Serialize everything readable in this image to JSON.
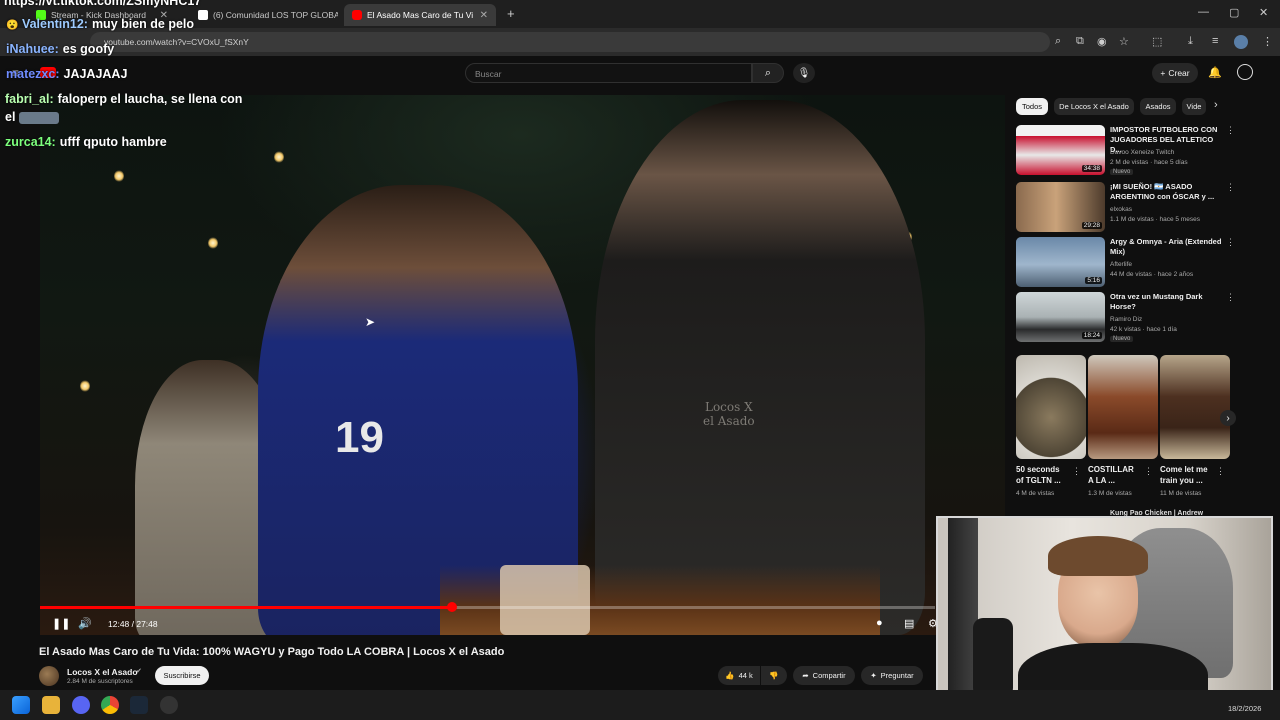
{
  "browser": {
    "tabs": [
      {
        "title": "Stream - Kick Dashboard",
        "favicon_color": "#53fc18"
      },
      {
        "title": "(6) Comunidad LOS TOP GLOBAL",
        "favicon_color": "#ffffff"
      },
      {
        "title": "El Asado Mas Caro de Tu Vi",
        "favicon_color": "#ff0000"
      }
    ],
    "new_tab_label": "+",
    "url": "youtube.com/watch?v=CVOxU_fSXnY"
  },
  "youtube": {
    "search_placeholder": "Buscar",
    "create_label": "Crear",
    "chips": [
      "Todos",
      "De Locos X el Asado",
      "Asados",
      "Vide"
    ],
    "video": {
      "title": "El Asado Mas Caro de Tu Vida: 100% WAGYU y Pago Todo LA COBRA | Locos X el Asado",
      "time": "12:48 / 27:48",
      "progress": 0.46,
      "channel": "Locos X el Asado",
      "subscribers": "2.84 M de suscriptores",
      "subscribe_label": "Suscribirse",
      "likes": "44 k",
      "share_label": "Compartir",
      "ask_label": "Preguntar"
    },
    "recommendations": [
      {
        "title": "IMPOSTOR FUTBOLERO CON JUGADORES DEL ATLETICO D...",
        "channel": "Davoo Xeneize Twitch",
        "meta": "2 M de vistas · hace 5 días",
        "duration": "34:38",
        "badge": "Nuevo"
      },
      {
        "title": "¡MI SUEÑO! 🇦🇷 ASADO ARGENTINO con ÓSCAR y ...",
        "channel": "elxokas",
        "meta": "1.1 M de vistas · hace 5 meses",
        "duration": "29:28",
        "badge": ""
      },
      {
        "title": "Argy & Omnya - Aria (Extended Mix)",
        "channel": "Afterlife",
        "meta": "44 M de vistas · hace 2 años",
        "duration": "5:16",
        "badge": ""
      },
      {
        "title": "Otra vez un Mustang Dark Horse?",
        "channel": "Ramiro Diz",
        "meta": "42 k vistas · hace 1 día",
        "duration": "18:24",
        "badge": "Nuevo"
      }
    ],
    "shorts": [
      {
        "title": "50 seconds of TGLTN ...",
        "views": "4 M de vistas"
      },
      {
        "title": "COSTILLAR A LA ...",
        "views": "1.3 M de vistas"
      },
      {
        "title": "Come let me train you ...",
        "views": "11 M de vistas"
      }
    ],
    "next_peek": "Kung Pao Chicken | Andrew"
  },
  "chat": [
    {
      "user": "Valentin12:",
      "message": "muy bien de pelo",
      "color": "#9ecbff"
    },
    {
      "user": "iNahuee:",
      "message": "es goofy",
      "color": "#8ab4ff"
    },
    {
      "user": "matezxc:",
      "message": "JAJAJAAJ",
      "color": "#6f8cff"
    },
    {
      "user": "fabri_al:",
      "message": "faloperp el laucha, se llena con",
      "color": "#b9ffb0"
    },
    {
      "user": "",
      "message": "el",
      "color": "#ffffff"
    },
    {
      "user": "zurca14:",
      "message": "ufff qputo hambre",
      "color": "#7dff7d"
    }
  ],
  "chat_top_partial": "https://vt.tiktok.com/ZSmyNHC17",
  "taskbar": {
    "date": "18/2/2026"
  }
}
